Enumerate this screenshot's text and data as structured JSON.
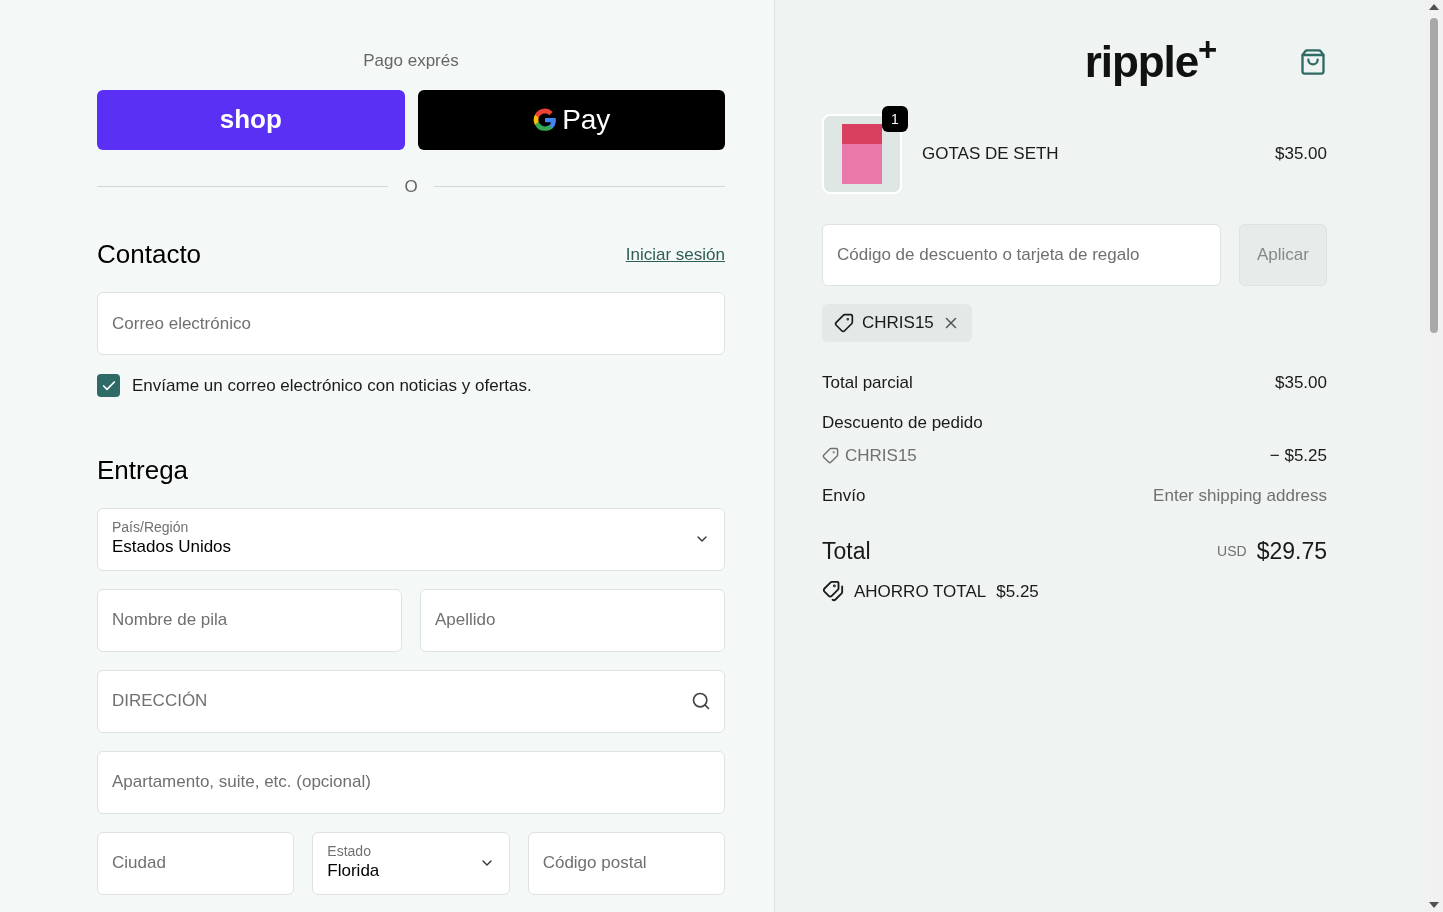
{
  "express": {
    "heading": "Pago exprés",
    "buttons": [
      {
        "kind": "shop",
        "label": "shop"
      },
      {
        "kind": "gpay",
        "label": "Pay"
      }
    ],
    "divider": "O"
  },
  "contact": {
    "title": "Contacto",
    "login_link": "Iniciar sesión",
    "email": {
      "placeholder": "Correo electrónico"
    },
    "newsletter": {
      "label": "Envíame un correo electrónico con noticias y ofertas.",
      "checked": true
    }
  },
  "delivery": {
    "title": "Entrega",
    "rows": [
      [
        {
          "kind": "select",
          "label": "País/Región",
          "value": "Estados Unidos"
        }
      ],
      [
        {
          "kind": "input",
          "placeholder": "Nombre de pila"
        },
        {
          "kind": "input",
          "placeholder": "Apellido"
        }
      ],
      [
        {
          "kind": "search",
          "placeholder": "DIRECCIÓN"
        }
      ],
      [
        {
          "kind": "input",
          "placeholder": "Apartamento, suite, etc. (opcional)"
        }
      ],
      [
        {
          "kind": "input",
          "placeholder": "Ciudad"
        },
        {
          "kind": "select",
          "label": "Estado",
          "value": "Florida"
        },
        {
          "kind": "input",
          "placeholder": "Código postal"
        }
      ]
    ]
  },
  "summary": {
    "logo": "ripple$^{+}$",
    "product": {
      "quantity": "1",
      "name": "GOTAS DE SETH",
      "price": "$35.00"
    },
    "discount": {
      "placeholder": "Código de descuento o tarjeta de regalo",
      "button": "Aplicar"
    },
    "applied_code": "CHRIS15",
    "subtotal": {
      "label": "Total parcial",
      "value": "$35.00"
    },
    "order_discount": {
      "label": "Descuento de pedido",
      "code": "CHRIS15",
      "value": "− $5.25"
    },
    "shipping": {
      "label": "Envío",
      "value": "Enter shipping address"
    },
    "total": {
      "label": "Total",
      "currency": "USD",
      "value": "$29.75"
    },
    "savings": {
      "label": "AHORRO TOTAL",
      "value": "$5.25"
    }
  }
}
